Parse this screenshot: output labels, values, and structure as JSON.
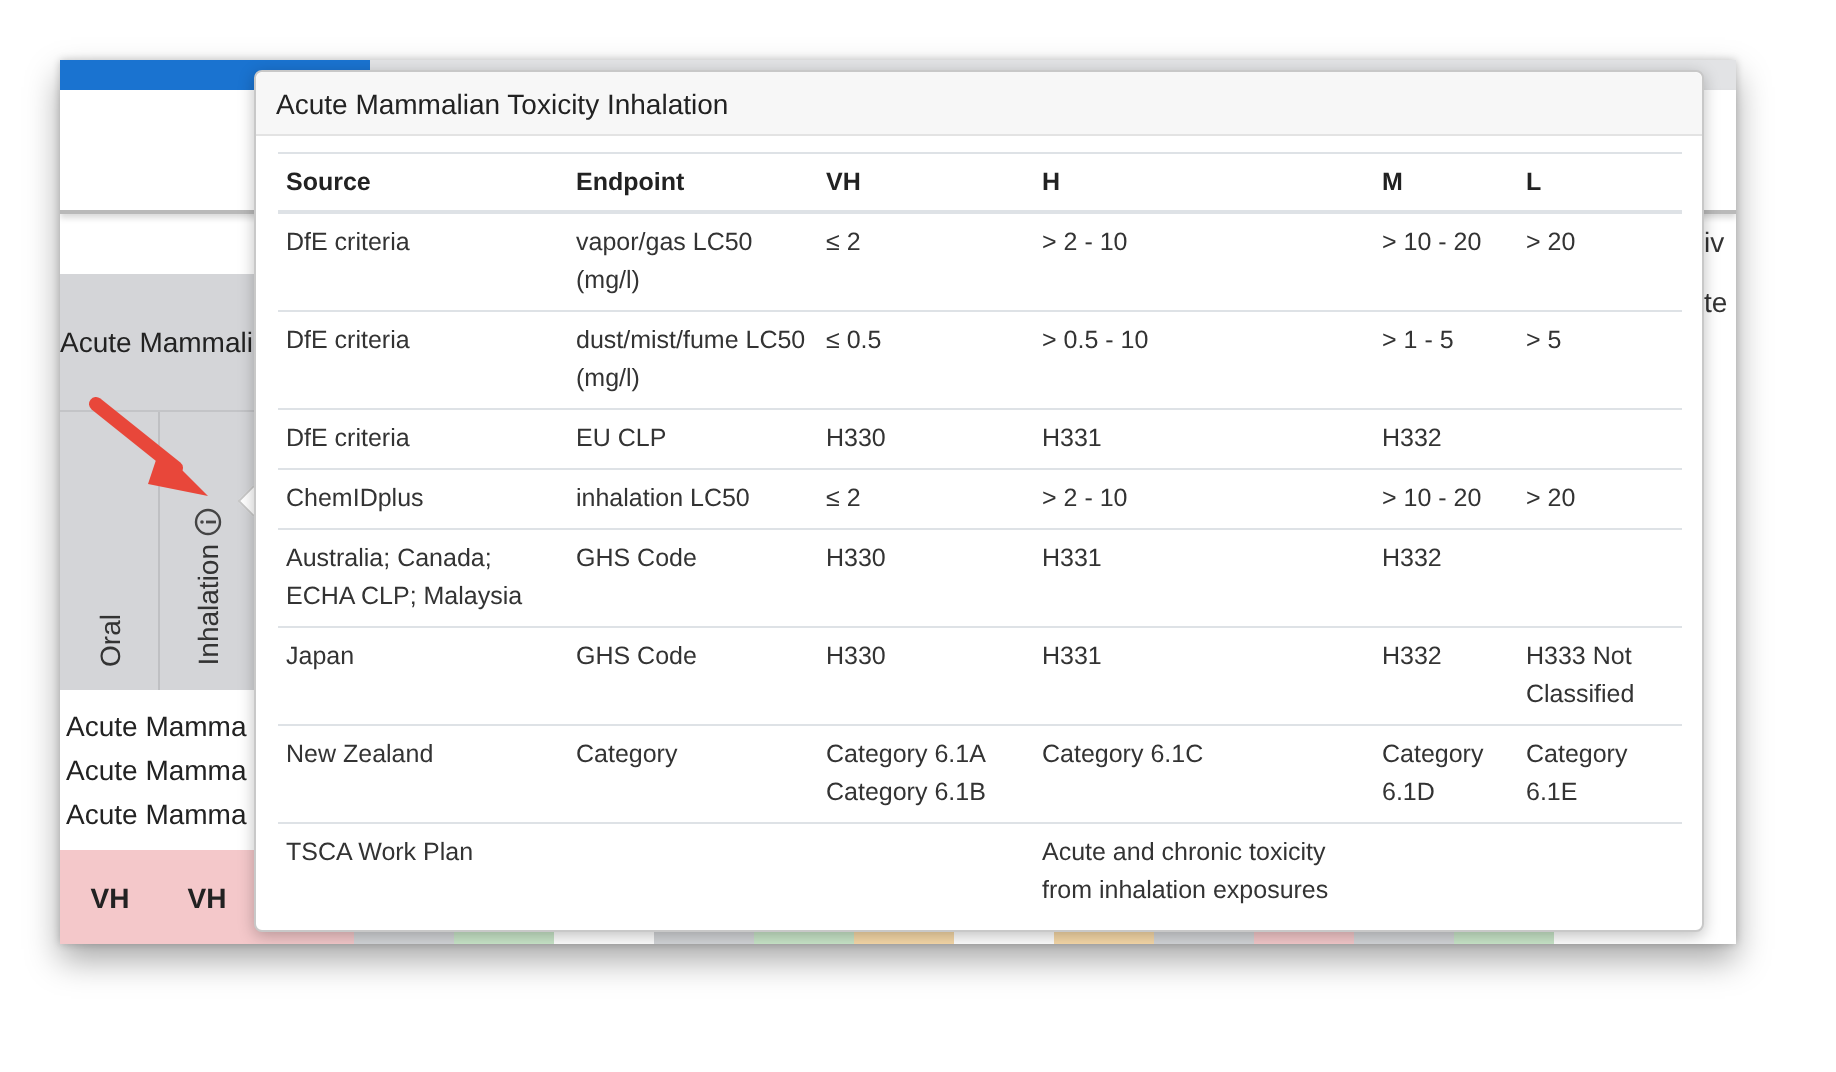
{
  "background": {
    "group_header": "Acute Mammali",
    "columns": [
      {
        "label": "Oral",
        "info": false
      },
      {
        "label": "Inhalation",
        "info": true
      }
    ],
    "row_labels": [
      "Acute Mamma",
      "Acute Mamma",
      "Acute Mamma"
    ],
    "hazard_cells": [
      {
        "text": "VH",
        "color": "#f4c8ca"
      },
      {
        "text": "VH",
        "color": "#f4c8ca"
      },
      {
        "color": "#f4c8ca"
      },
      {
        "color": "#d3d5d8"
      },
      {
        "color": "#c9e6c9"
      },
      {
        "color": "#ffffff"
      },
      {
        "color": "#d3d5d8"
      },
      {
        "color": "#c9e6c9"
      },
      {
        "color": "#f7d9a8"
      },
      {
        "color": "#ffffff"
      },
      {
        "color": "#f7d9a8"
      },
      {
        "color": "#d3d5d8"
      },
      {
        "color": "#f4c8ca"
      },
      {
        "color": "#d3d5d8"
      },
      {
        "color": "#c9e6c9"
      }
    ],
    "right_fragments": [
      "iv",
      "te"
    ]
  },
  "popover": {
    "title": "Acute Mammalian Toxicity Inhalation",
    "columns": [
      "Source",
      "Endpoint",
      "VH",
      "H",
      "M",
      "L"
    ],
    "rows": [
      [
        "DfE criteria",
        "vapor/gas LC50 (mg/l)",
        "≤ 2",
        "> 2 - 10",
        "> 10 - 20",
        "> 20"
      ],
      [
        "DfE criteria",
        "dust/mist/fume LC50 (mg/l)",
        "≤ 0.5",
        "> 0.5 - 10",
        "> 1 - 5",
        "> 5"
      ],
      [
        "DfE criteria",
        "EU CLP",
        "H330",
        "H331",
        "H332",
        null
      ],
      [
        "ChemIDplus",
        "inhalation LC50",
        "≤ 2",
        "> 2 - 10",
        "> 10 - 20",
        "> 20"
      ],
      [
        "Australia; Canada; ECHA CLP; Malaysia",
        "GHS Code",
        "H330",
        "H331",
        "H332",
        null
      ],
      [
        "Japan",
        "GHS Code",
        "H330",
        "H331",
        "H332",
        "H333 Not Classified"
      ],
      [
        "New Zealand",
        "Category",
        "Category 6.1A Category 6.1B",
        "Category 6.1C",
        "Category 6.1D",
        "Category 6.1E"
      ],
      [
        "TSCA Work Plan",
        null,
        null,
        "Acute and chronic toxicity from inhalation exposures",
        null,
        null
      ]
    ]
  }
}
